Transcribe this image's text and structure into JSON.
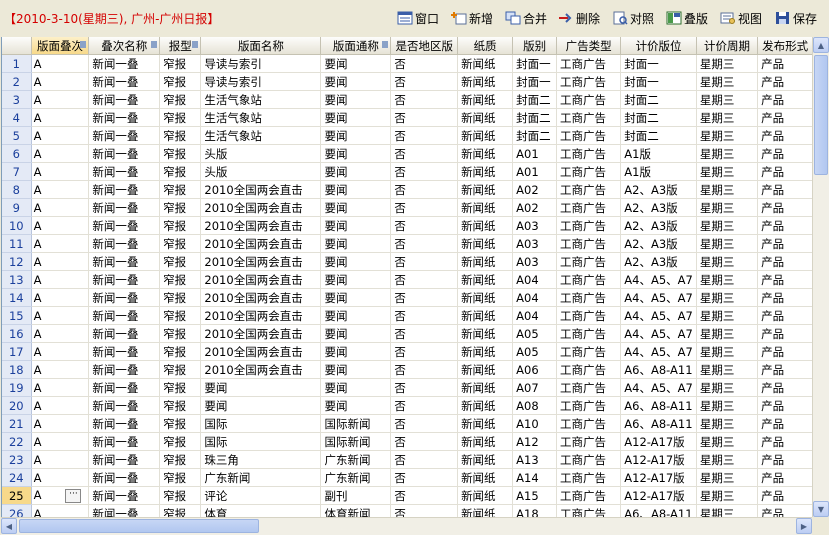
{
  "header": {
    "title": "【2010-3-10(星期三), 广州-广州日报】"
  },
  "toolbar": [
    {
      "label": "窗口",
      "icon": "window-icon"
    },
    {
      "label": "新增",
      "icon": "add-icon"
    },
    {
      "label": "合并",
      "icon": "merge-icon"
    },
    {
      "label": "删除",
      "icon": "delete-icon"
    },
    {
      "label": "对照",
      "icon": "compare-icon"
    },
    {
      "label": "叠版",
      "icon": "stack-icon"
    },
    {
      "label": "视图",
      "icon": "view-icon"
    },
    {
      "label": "保存",
      "icon": "save-icon"
    }
  ],
  "grid": {
    "columns": [
      "版面叠次",
      "叠次名称",
      "报型",
      "版面名称",
      "版面通称",
      "是否地区版",
      "纸质",
      "版别",
      "广告类型",
      "计价版位",
      "计价周期",
      "发布形式"
    ],
    "selected_row": 25,
    "rows": [
      [
        "A",
        "新闻一叠",
        "窄报",
        "导读与索引",
        "要闻",
        "否",
        "新闻纸",
        "封面一",
        "工商广告",
        "封面一",
        "星期三",
        "产品"
      ],
      [
        "A",
        "新闻一叠",
        "窄报",
        "导读与索引",
        "要闻",
        "否",
        "新闻纸",
        "封面一",
        "工商广告",
        "封面一",
        "星期三",
        "产品"
      ],
      [
        "A",
        "新闻一叠",
        "窄报",
        "生活气象站",
        "要闻",
        "否",
        "新闻纸",
        "封面二",
        "工商广告",
        "封面二",
        "星期三",
        "产品"
      ],
      [
        "A",
        "新闻一叠",
        "窄报",
        "生活气象站",
        "要闻",
        "否",
        "新闻纸",
        "封面二",
        "工商广告",
        "封面二",
        "星期三",
        "产品"
      ],
      [
        "A",
        "新闻一叠",
        "窄报",
        "生活气象站",
        "要闻",
        "否",
        "新闻纸",
        "封面二",
        "工商广告",
        "封面二",
        "星期三",
        "产品"
      ],
      [
        "A",
        "新闻一叠",
        "窄报",
        "头版",
        "要闻",
        "否",
        "新闻纸",
        "A01",
        "工商广告",
        "A1版",
        "星期三",
        "产品"
      ],
      [
        "A",
        "新闻一叠",
        "窄报",
        "头版",
        "要闻",
        "否",
        "新闻纸",
        "A01",
        "工商广告",
        "A1版",
        "星期三",
        "产品"
      ],
      [
        "A",
        "新闻一叠",
        "窄报",
        "2010全国两会直击",
        "要闻",
        "否",
        "新闻纸",
        "A02",
        "工商广告",
        "A2、A3版",
        "星期三",
        "产品"
      ],
      [
        "A",
        "新闻一叠",
        "窄报",
        "2010全国两会直击",
        "要闻",
        "否",
        "新闻纸",
        "A02",
        "工商广告",
        "A2、A3版",
        "星期三",
        "产品"
      ],
      [
        "A",
        "新闻一叠",
        "窄报",
        "2010全国两会直击",
        "要闻",
        "否",
        "新闻纸",
        "A03",
        "工商广告",
        "A2、A3版",
        "星期三",
        "产品"
      ],
      [
        "A",
        "新闻一叠",
        "窄报",
        "2010全国两会直击",
        "要闻",
        "否",
        "新闻纸",
        "A03",
        "工商广告",
        "A2、A3版",
        "星期三",
        "产品"
      ],
      [
        "A",
        "新闻一叠",
        "窄报",
        "2010全国两会直击",
        "要闻",
        "否",
        "新闻纸",
        "A03",
        "工商广告",
        "A2、A3版",
        "星期三",
        "产品"
      ],
      [
        "A",
        "新闻一叠",
        "窄报",
        "2010全国两会直击",
        "要闻",
        "否",
        "新闻纸",
        "A04",
        "工商广告",
        "A4、A5、A7",
        "星期三",
        "产品"
      ],
      [
        "A",
        "新闻一叠",
        "窄报",
        "2010全国两会直击",
        "要闻",
        "否",
        "新闻纸",
        "A04",
        "工商广告",
        "A4、A5、A7",
        "星期三",
        "产品"
      ],
      [
        "A",
        "新闻一叠",
        "窄报",
        "2010全国两会直击",
        "要闻",
        "否",
        "新闻纸",
        "A04",
        "工商广告",
        "A4、A5、A7",
        "星期三",
        "产品"
      ],
      [
        "A",
        "新闻一叠",
        "窄报",
        "2010全国两会直击",
        "要闻",
        "否",
        "新闻纸",
        "A05",
        "工商广告",
        "A4、A5、A7",
        "星期三",
        "产品"
      ],
      [
        "A",
        "新闻一叠",
        "窄报",
        "2010全国两会直击",
        "要闻",
        "否",
        "新闻纸",
        "A05",
        "工商广告",
        "A4、A5、A7",
        "星期三",
        "产品"
      ],
      [
        "A",
        "新闻一叠",
        "窄报",
        "2010全国两会直击",
        "要闻",
        "否",
        "新闻纸",
        "A06",
        "工商广告",
        "A6、A8-A11",
        "星期三",
        "产品"
      ],
      [
        "A",
        "新闻一叠",
        "窄报",
        "要闻",
        "要闻",
        "否",
        "新闻纸",
        "A07",
        "工商广告",
        "A4、A5、A7",
        "星期三",
        "产品"
      ],
      [
        "A",
        "新闻一叠",
        "窄报",
        "要闻",
        "要闻",
        "否",
        "新闻纸",
        "A08",
        "工商广告",
        "A6、A8-A11",
        "星期三",
        "产品"
      ],
      [
        "A",
        "新闻一叠",
        "窄报",
        "国际",
        "国际新闻",
        "否",
        "新闻纸",
        "A10",
        "工商广告",
        "A6、A8-A11",
        "星期三",
        "产品"
      ],
      [
        "A",
        "新闻一叠",
        "窄报",
        "国际",
        "国际新闻",
        "否",
        "新闻纸",
        "A12",
        "工商广告",
        "A12-A17版",
        "星期三",
        "产品"
      ],
      [
        "A",
        "新闻一叠",
        "窄报",
        "珠三角",
        "广东新闻",
        "否",
        "新闻纸",
        "A13",
        "工商广告",
        "A12-A17版",
        "星期三",
        "产品"
      ],
      [
        "A",
        "新闻一叠",
        "窄报",
        "广东新闻",
        "广东新闻",
        "否",
        "新闻纸",
        "A14",
        "工商广告",
        "A12-A17版",
        "星期三",
        "产品"
      ],
      [
        "A",
        "新闻一叠",
        "窄报",
        "评论",
        "副刊",
        "否",
        "新闻纸",
        "A15",
        "工商广告",
        "A12-A17版",
        "星期三",
        "产品"
      ],
      [
        "A",
        "新闻一叠",
        "窄报",
        "体育",
        "体育新闻",
        "否",
        "新闻纸",
        "A18",
        "工商广告",
        "A6、A8-A11",
        "星期三",
        "产品"
      ]
    ]
  }
}
